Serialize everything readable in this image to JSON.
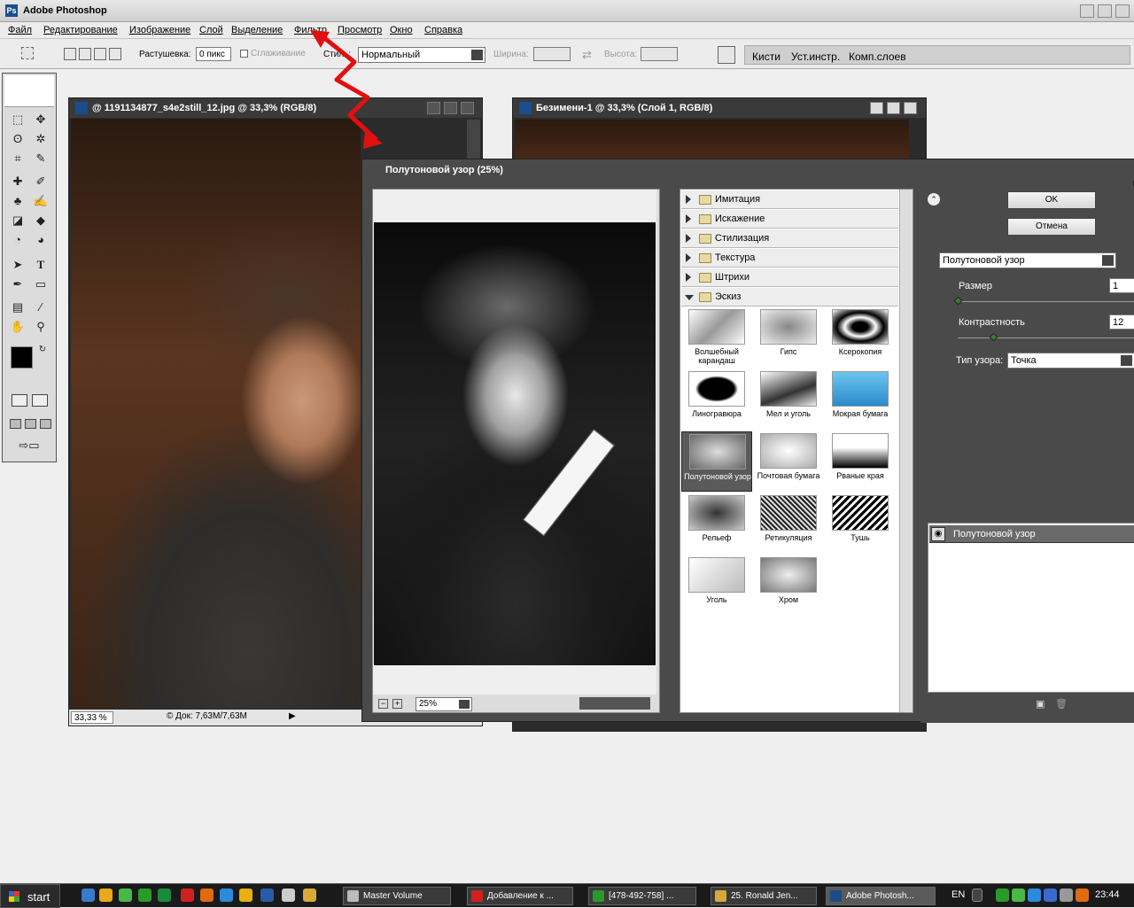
{
  "app": {
    "title": "Adobe Photoshop"
  },
  "menu": [
    "Файл",
    "Редактирование",
    "Изображение",
    "Слой",
    "Выделение",
    "Фильтр",
    "Просмотр",
    "Окно",
    "Справка"
  ],
  "options": {
    "feather_label": "Растушевка:",
    "feather_value": "0 пикс",
    "antialias_label": "Сглаживание",
    "style_label": "Стиль:",
    "style_value": "Нормальный",
    "width_label": "Ширина:",
    "height_label": "Высота:"
  },
  "palette_tabs": [
    "Кисти",
    "Уст.инстр.",
    "Комп.слоев"
  ],
  "doc1": {
    "title": "@ 1191134877_s4e2still_12.jpg @ 33,3% (RGB/8)",
    "zoom": "33,33 %",
    "info": "© Док: 7,63M/7,63M"
  },
  "doc2": {
    "title": "Безимени-1 @ 33,3% (Слой 1, RGB/8)"
  },
  "dialog": {
    "title": "Полутоновой узор (25%)",
    "zoom": "25%"
  },
  "categories": [
    "Имитация",
    "Искажение",
    "Стилизация",
    "Текстура",
    "Штрихи",
    "Эскиз"
  ],
  "filters": [
    "Волшебный карандаш",
    "Гипс",
    "Ксерокопия",
    "Линогравюра",
    "Мел и уголь",
    "Мокрая бумага",
    "Полутоновой узор",
    "Почтовая бумага",
    "Рваные края",
    "Рельеф",
    "Ретикуляция",
    "Тушь",
    "Уголь",
    "Хром"
  ],
  "settings": {
    "ok": "OK",
    "cancel": "Отмена",
    "filter_select": "Полутоновой узор",
    "size_label": "Размер",
    "size_value": "1",
    "contrast_label": "Контрастность",
    "contrast_value": "12",
    "pattern_label": "Тип узора:",
    "pattern_value": "Точка",
    "layer_name": "Полутоновой узор",
    "size_level": 0.0,
    "contrast_level": 0.2
  },
  "taskbar": {
    "start": "start",
    "lang": "EN",
    "clock": "23:44",
    "buttons": [
      "Master Volume",
      "Добавление к ...",
      "[478-492-758] ...",
      "25. Ronald Jen...",
      "Adobe Photosh..."
    ]
  },
  "colors": {
    "accent": "#1b4d8c",
    "selected": "#5a5a5a",
    "arrow": "#e01010"
  }
}
